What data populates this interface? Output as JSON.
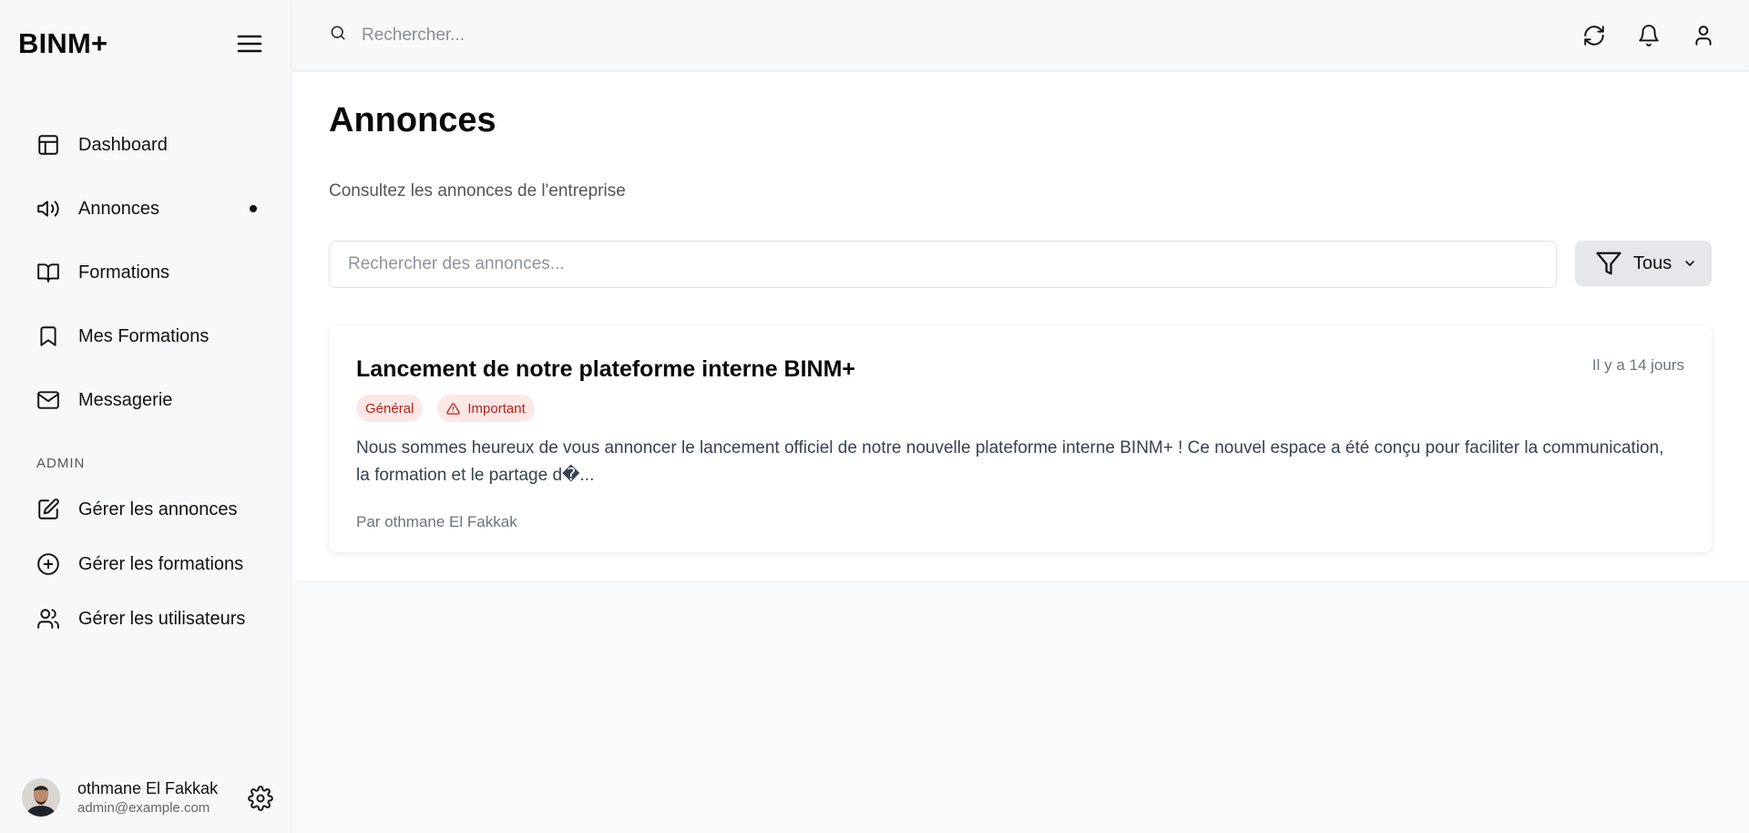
{
  "brand": "BINM+",
  "topbar": {
    "search_placeholder": "Rechercher..."
  },
  "sidebar": {
    "items": [
      {
        "label": "Dashboard"
      },
      {
        "label": "Annonces"
      },
      {
        "label": "Formations"
      },
      {
        "label": "Mes Formations"
      },
      {
        "label": "Messagerie"
      }
    ],
    "admin_heading": "ADMIN",
    "admin_items": [
      {
        "label": "Gérer les annonces"
      },
      {
        "label": "Gérer les formations"
      },
      {
        "label": "Gérer les utilisateurs"
      }
    ]
  },
  "user": {
    "name": "othmane El Fakkak",
    "email": "admin@example.com"
  },
  "page": {
    "title": "Annonces",
    "subtitle": "Consultez les annonces de l'entreprise",
    "search_placeholder": "Rechercher des annonces...",
    "filter_label": "Tous"
  },
  "announcements": [
    {
      "title": "Lancement de notre plateforme interne BINM+",
      "date": "Il y a 14 jours",
      "badges": [
        "Général",
        "Important"
      ],
      "excerpt": "Nous sommes heureux de vous annoncer le lancement officiel de notre nouvelle plateforme interne BINM+ ! Ce nouvel espace a été conçu pour faciliter la communication, la formation et le partage d�...",
      "author": "Par othmane El Fakkak"
    }
  ],
  "colors": {
    "badge_bg": "#fde7e7",
    "badge_text": "#b42318",
    "filter_bg": "#e5e7eb"
  }
}
